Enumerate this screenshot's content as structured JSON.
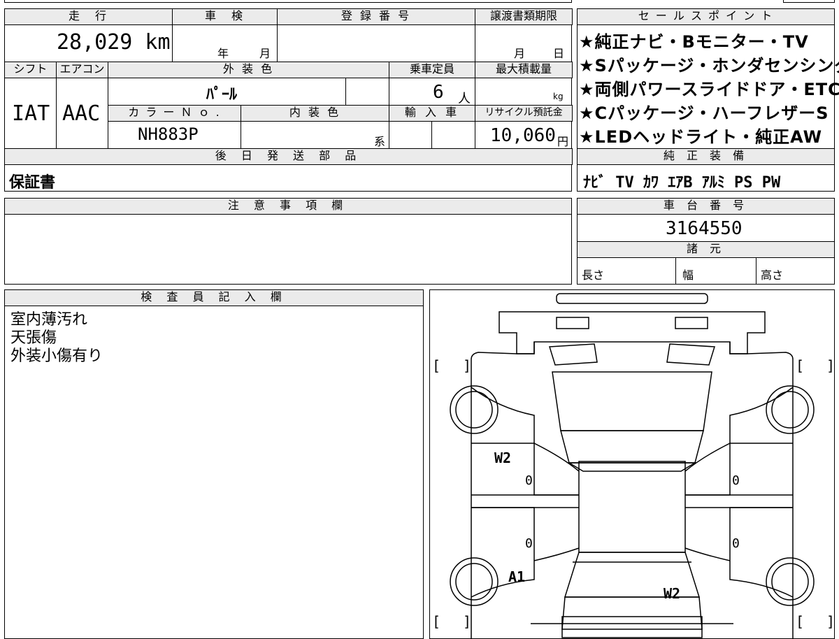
{
  "header_row": {
    "mileage_label": "走　行",
    "inspection_label": "車　検",
    "registration_label": "登 録 番 号",
    "transfer_deadline_label": "譲渡書類期限",
    "mileage_value": "28,029 km",
    "inspection_year": "年",
    "inspection_month": "月",
    "deadline_month": "月",
    "deadline_day": "日"
  },
  "spec_row": {
    "shift_label": "シフト",
    "aircon_label": "エアコン",
    "exterior_color_label": "外 装 色",
    "capacity_label": "乗車定員",
    "max_load_label": "最大積載量",
    "shift_value": "IAT",
    "aircon_value": "AAC",
    "exterior_color_value": "ﾊﾟｰﾙ",
    "capacity_value": "6",
    "capacity_unit": "人",
    "load_unit": "kg",
    "color_no_label": "カ ラ ー Ｎ ｏ .",
    "interior_color_label": "内 装 色",
    "import_label": "輸 入 車",
    "recycle_label": "リサイクル預託金",
    "color_no_value": "NH883P",
    "interior_suffix": "系",
    "recycle_value": "10,060",
    "recycle_unit": "円"
  },
  "sales_points": {
    "label": "セ ー ル ス ポ イ ン ト",
    "items": [
      "★純正ナビ・Bモニター・TV",
      "★Sパッケージ・ホンダセンシング",
      "★両側パワースライドドア・ETC",
      "★Cパッケージ・ハーフレザーS",
      "★LEDヘッドライト・純正AW"
    ]
  },
  "later_parts": {
    "label": "後 日 発 送 部 品",
    "value": "保証書"
  },
  "factory_equipment": {
    "label": "純 正 装 備",
    "value": "ﾅﾋﾞ TV ｶﾜ ｴｱB ｱﾙﾐ PS PW"
  },
  "notes": {
    "label": "注 意 事 項 欄",
    "value": ""
  },
  "chassis_number": {
    "label": "車 台 番 号",
    "value": "3164550"
  },
  "specifications": {
    "label": "諸 元",
    "length": "長さ",
    "width": "幅",
    "height": "高さ"
  },
  "inspector": {
    "label": "検 査 員 記 入 欄",
    "lines": [
      "室内薄汚れ",
      "天張傷",
      "外装小傷有り"
    ]
  },
  "diagram": {
    "marks": [
      "W2",
      "A1",
      "W2"
    ],
    "zeros": [
      "0",
      "0",
      "0",
      "0"
    ],
    "brackets": [
      "[",
      "]",
      "[",
      "]",
      "[",
      "]",
      "[",
      "]"
    ]
  }
}
